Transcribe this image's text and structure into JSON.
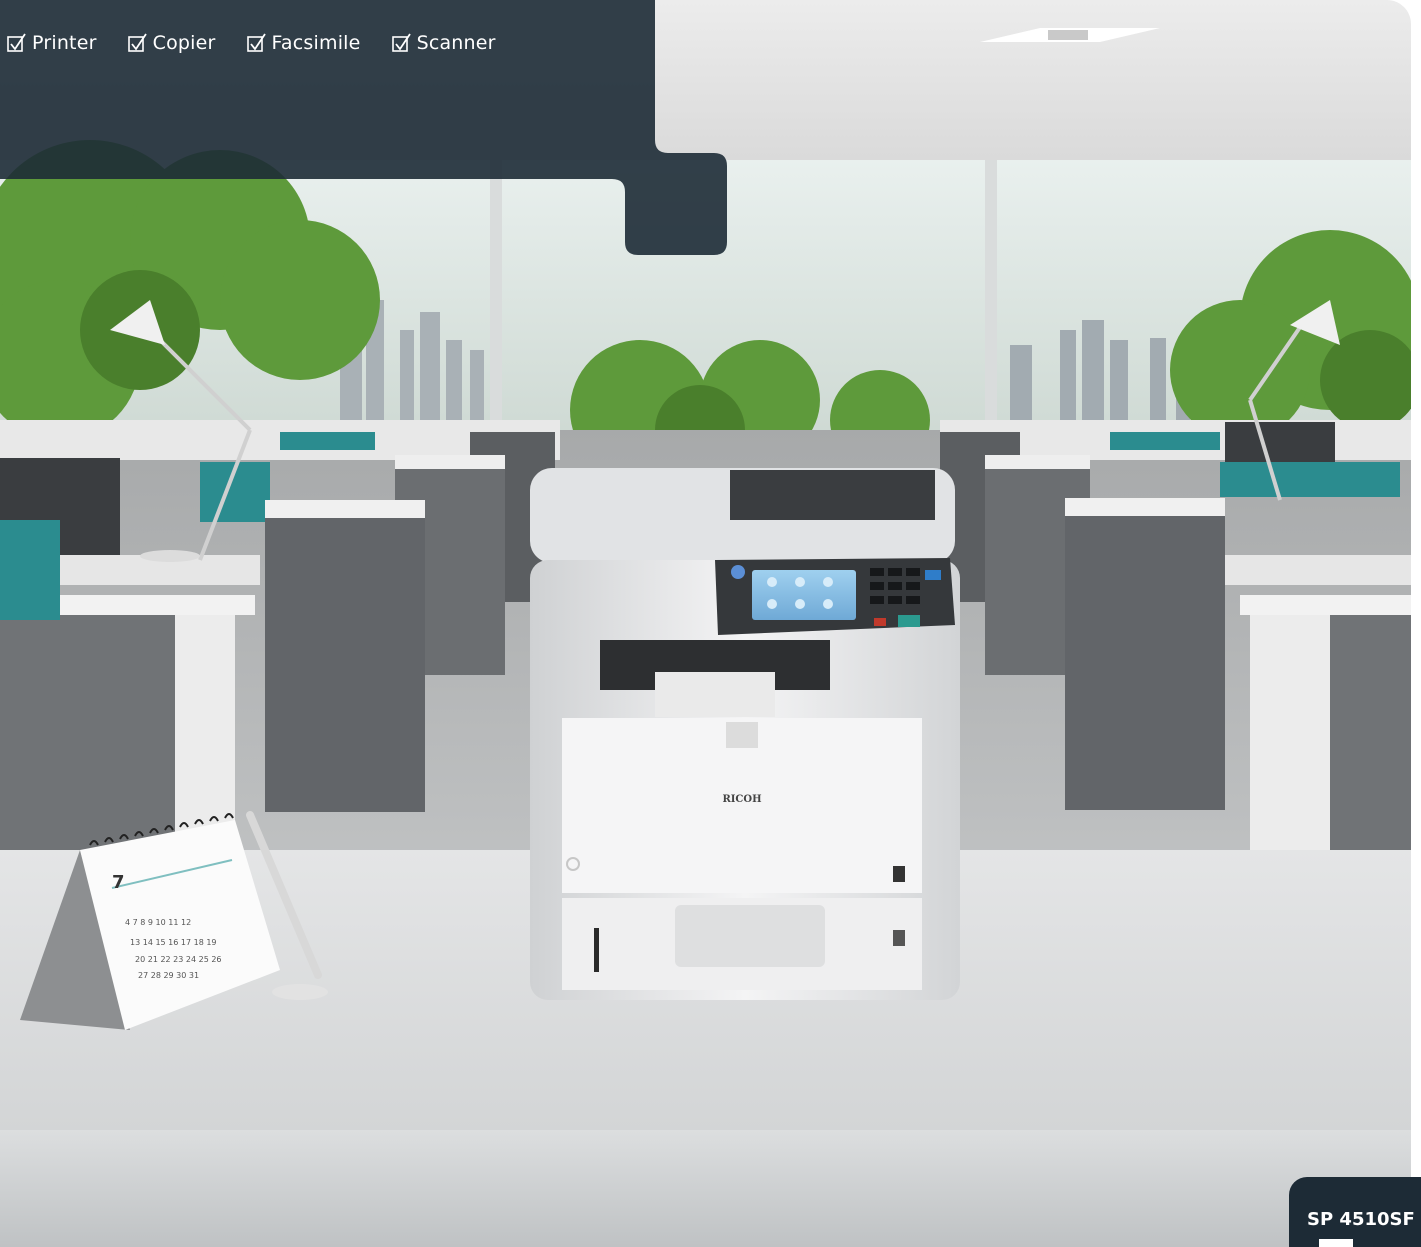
{
  "features": [
    {
      "label": "Printer",
      "icon": "checkbox-icon"
    },
    {
      "label": "Copier",
      "icon": "checkbox-icon"
    },
    {
      "label": "Facsimile",
      "icon": "checkbox-icon"
    },
    {
      "label": "Scanner",
      "icon": "checkbox-icon"
    }
  ],
  "product": {
    "model": "SP 4510SF",
    "printer_brand": "RICOH"
  },
  "calendar": {
    "month": "7"
  },
  "colors": {
    "overlay": "#1d2b36",
    "accent_teal": "#2b8c8f"
  }
}
